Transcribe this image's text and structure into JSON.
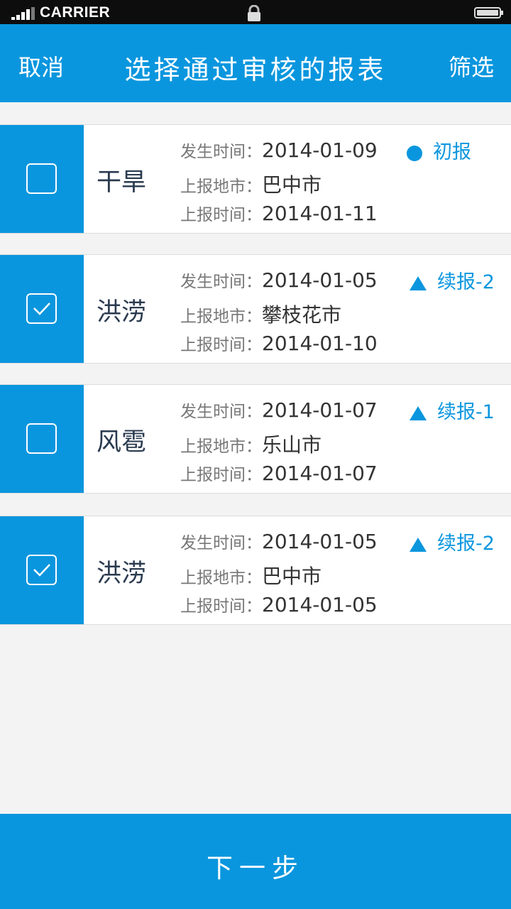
{
  "status_bar": {
    "carrier": "CARRIER",
    "icons": [
      "signal-icon",
      "lock-icon",
      "battery-icon"
    ]
  },
  "header": {
    "cancel_label": "取消",
    "title": "选择通过审核的报表",
    "filter_label": "筛选"
  },
  "labels": {
    "occur_time": "发生时间：",
    "report_city": "上报地市：",
    "report_time": "上报时间："
  },
  "reports": [
    {
      "type": "干旱",
      "occur_time": "2014-01-09",
      "city": "巴中市",
      "report_time": "2014-01-11",
      "status": "初报",
      "status_icon": "circle",
      "checked": false
    },
    {
      "type": "洪涝",
      "occur_time": "2014-01-05",
      "city": "攀枝花市",
      "report_time": "2014-01-10",
      "status": "续报-2",
      "status_icon": "triangle",
      "checked": true
    },
    {
      "type": "风雹",
      "occur_time": "2014-01-07",
      "city": "乐山市",
      "report_time": "2014-01-07",
      "status": "续报-1",
      "status_icon": "triangle",
      "checked": false
    },
    {
      "type": "洪涝",
      "occur_time": "2014-01-05",
      "city": "巴中市",
      "report_time": "2014-01-05",
      "status": "续报-2",
      "status_icon": "triangle",
      "checked": true
    }
  ],
  "footer": {
    "next_label": "下一步"
  },
  "colors": {
    "accent": "#0a96de",
    "background": "#f3f3f3",
    "card": "#ffffff"
  }
}
